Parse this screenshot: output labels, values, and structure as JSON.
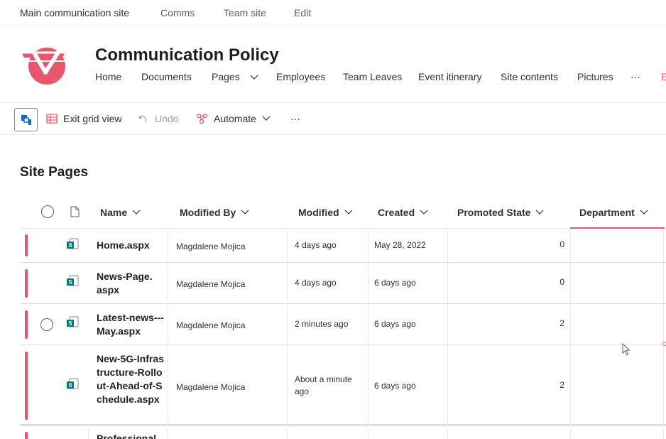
{
  "hub_nav": [
    "Main communication site",
    "Comms",
    "Team site",
    "Edit"
  ],
  "site": {
    "title": "Communication Policy",
    "nav": [
      "Home",
      "Documents",
      "Pages",
      "Employees",
      "Team Leaves",
      "Event itinerary",
      "Site contents",
      "Pictures",
      "···",
      "E"
    ]
  },
  "command_bar": {
    "exit_grid": "Exit grid view",
    "undo": "Undo",
    "automate": "Automate",
    "more": "···"
  },
  "list": {
    "title": "Site Pages",
    "columns": [
      "Name",
      "Modified By",
      "Modified",
      "Created",
      "Promoted State",
      "Department"
    ],
    "rows": [
      {
        "name": "Home.aspx",
        "modified_by": "Magdalene Mojica",
        "modified": "4 days ago",
        "created": "May 28, 2022",
        "promoted_state": "0",
        "department": ""
      },
      {
        "name": "News-Page.aspx",
        "modified_by": "Magdalene Mojica",
        "modified": "4 days ago",
        "created": "6 days ago",
        "promoted_state": "0",
        "department": ""
      },
      {
        "name": "Latest-news---May.aspx",
        "modified_by": "Magdalene Mojica",
        "modified": "2 minutes ago",
        "created": "6 days ago",
        "promoted_state": "2",
        "department": ""
      },
      {
        "name": "New-5G-Infrastructure-Rollout-Ahead-of-Schedule.aspx",
        "modified_by": "Magdalene Mojica",
        "modified": "About a minute ago",
        "created": "6 days ago",
        "promoted_state": "2",
        "department": ""
      },
      {
        "name": "Professional",
        "modified_by": "",
        "modified": "",
        "created": "",
        "promoted_state": "",
        "department": ""
      }
    ]
  },
  "colors": {
    "accent": "#e8566e",
    "text": "#323130",
    "border": "#edebe9"
  },
  "icons": [
    "sharepoint-icon",
    "grid-icon",
    "undo-icon",
    "automate-icon",
    "chevron-down-icon",
    "page-file-icon",
    "select-circle-icon",
    "mouse-cursor-icon"
  ]
}
